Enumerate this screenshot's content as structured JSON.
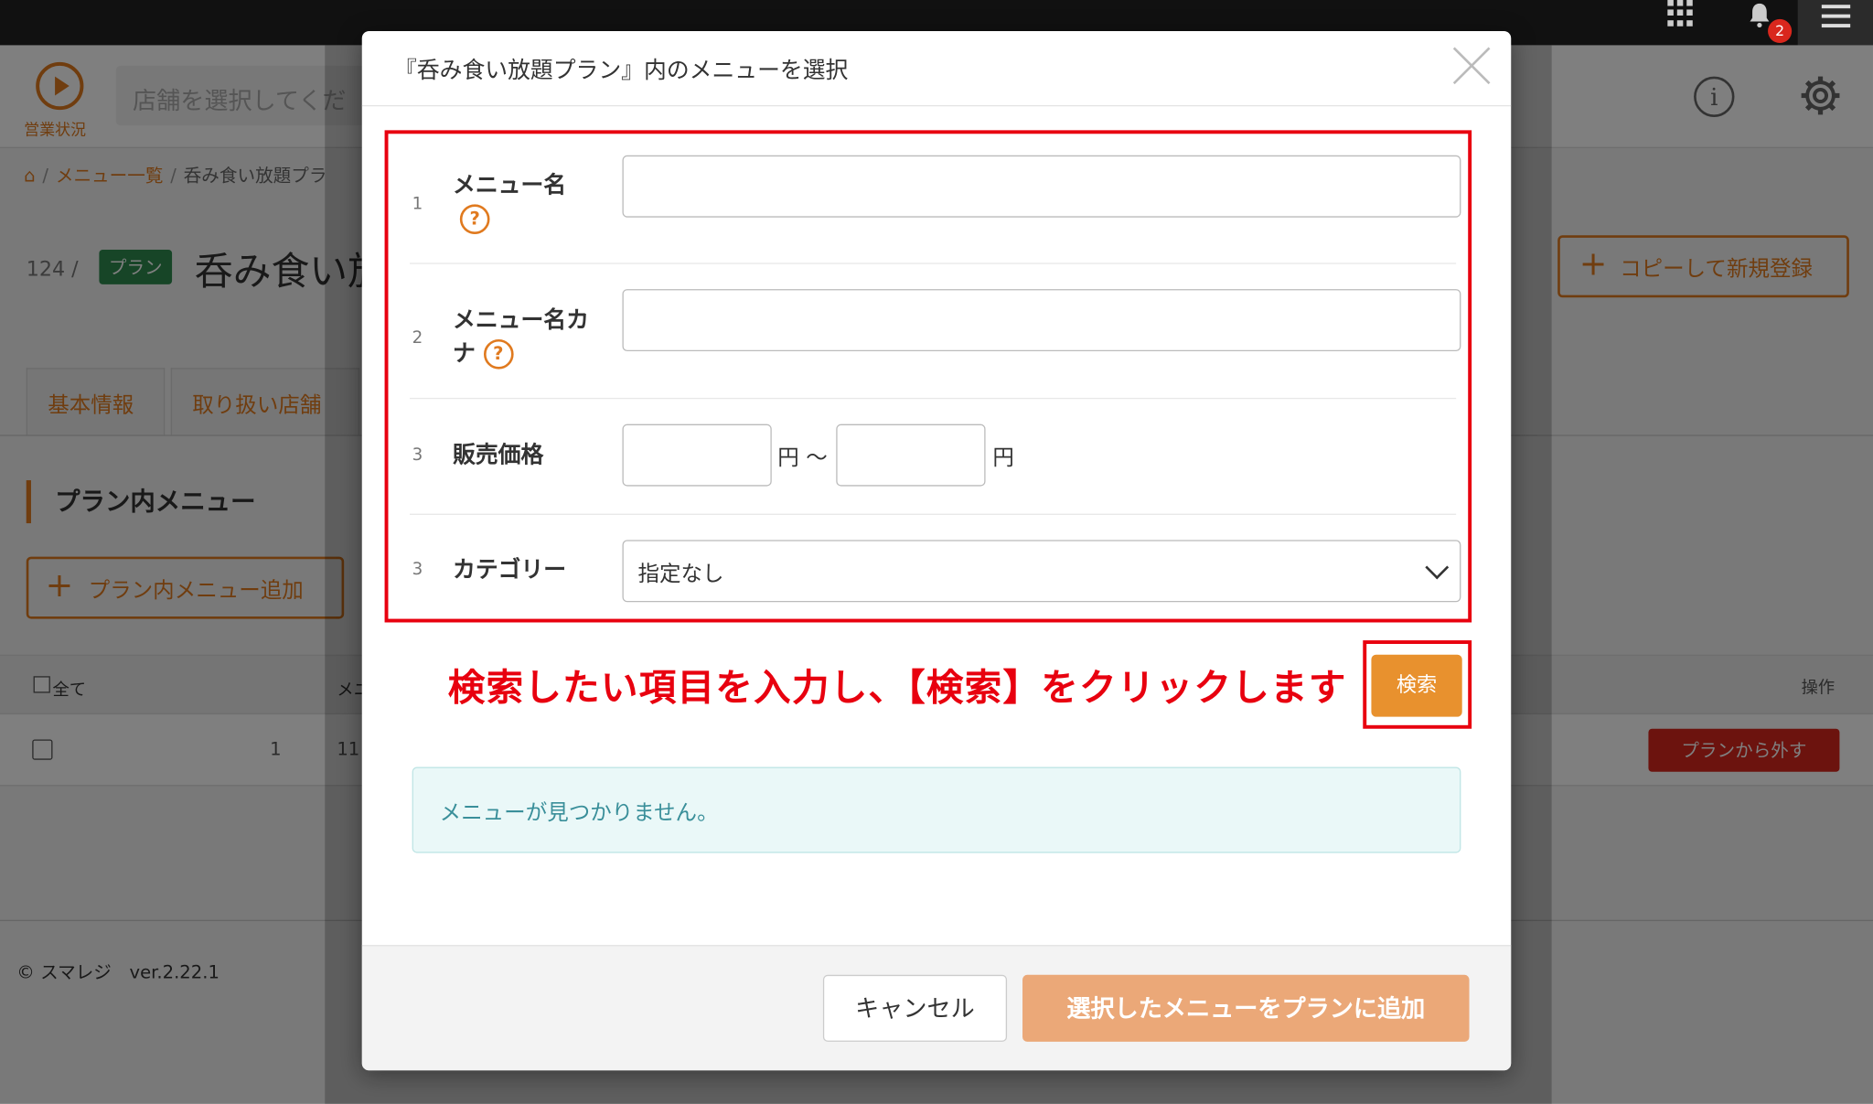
{
  "topbar": {
    "notification_count": "2"
  },
  "header": {
    "status_label": "営業状況",
    "store_placeholder": "店舗を選択してくだ"
  },
  "breadcrumb": {
    "items": [
      "メニュー一覧",
      "呑み食い放題プラ"
    ]
  },
  "page": {
    "id": "124 /",
    "badge": "プラン",
    "title": "呑み食い放",
    "copy_button": "コピーして新規登録"
  },
  "tabs": [
    "基本情報",
    "取り扱い店舗"
  ],
  "section": {
    "title": "プラン内メニュー",
    "add_button": "プラン内メニュー追加"
  },
  "table": {
    "select_all": "全て",
    "col_menu": "メニ",
    "col_operation": "操作",
    "rows": [
      {
        "num": "1",
        "code": "11",
        "action": "プランから外す"
      }
    ]
  },
  "footer": {
    "text": "© スマレジ　ver.2.22.1"
  },
  "modal": {
    "title": "『呑み食い放題プラン』内のメニューを選択",
    "fields": [
      {
        "num": "1",
        "label": "メニュー名",
        "value": ""
      },
      {
        "num": "2",
        "label": "メニュー名カナ",
        "value": ""
      },
      {
        "num": "3",
        "label": "販売価格",
        "unit": "円",
        "range_sep": "円 〜"
      },
      {
        "num": "3",
        "label": "カテゴリー",
        "selected": "指定なし"
      }
    ],
    "help_glyph": "?",
    "annotation": "検索したい項目を入力し、【検索】をクリックします",
    "search_button": "検索",
    "empty_message": "メニューが見つかりません。",
    "cancel_button": "キャンセル",
    "submit_button": "選択したメニューをプランに追加"
  },
  "colors": {
    "accent": "#e07a1f",
    "highlight": "#e8000f",
    "search_button": "#e8912e",
    "submit_button": "#eba878",
    "danger": "#d9271d",
    "plan_badge": "#2e8b4f"
  }
}
